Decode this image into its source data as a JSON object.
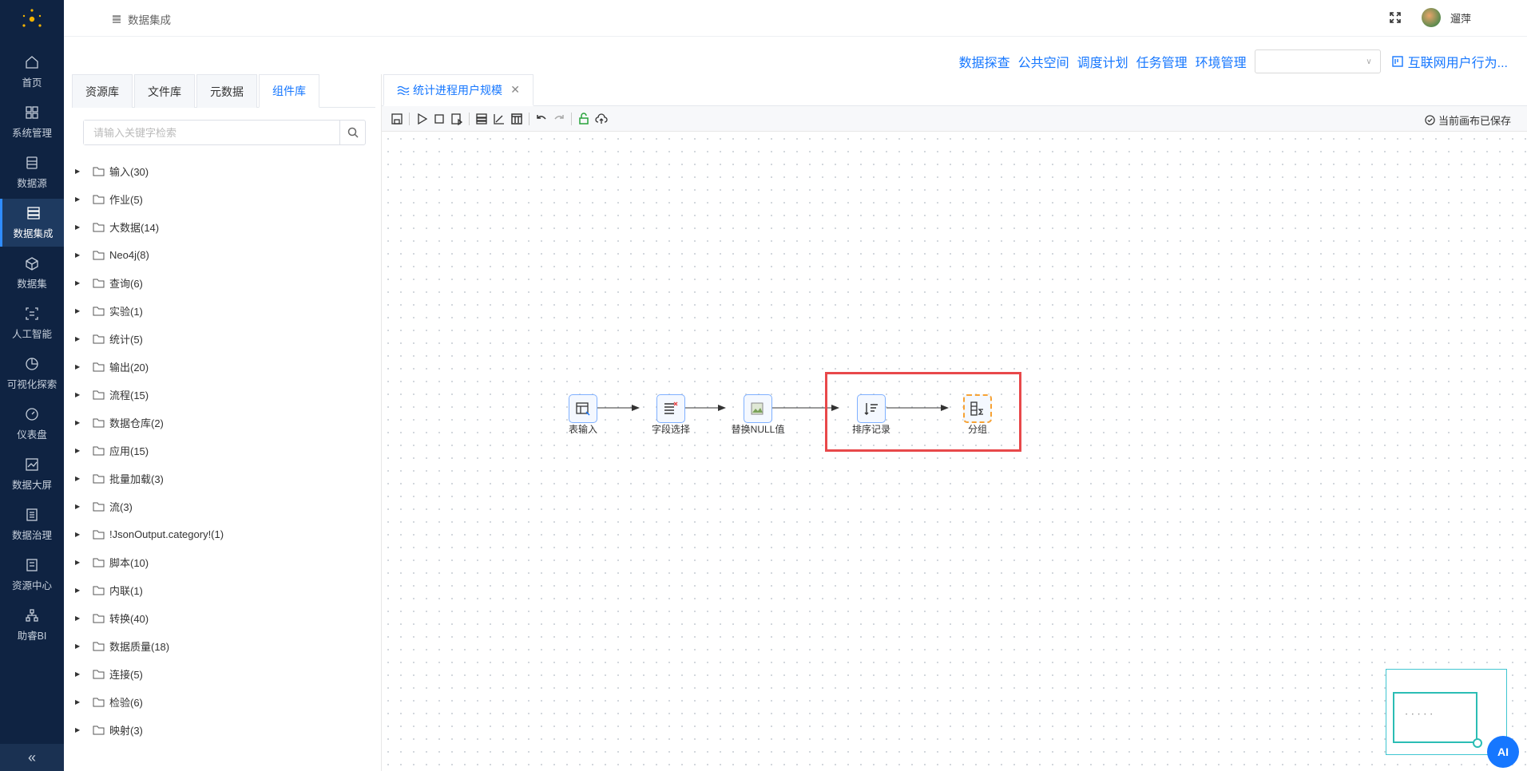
{
  "nav": {
    "items": [
      {
        "label": "首页",
        "icon": "home-icon"
      },
      {
        "label": "系统管理",
        "icon": "grid-icon"
      },
      {
        "label": "数据源",
        "icon": "database-icon"
      },
      {
        "label": "数据集成",
        "icon": "server-icon"
      },
      {
        "label": "数据集",
        "icon": "cube-icon"
      },
      {
        "label": "人工智能",
        "icon": "ai-icon"
      },
      {
        "label": "可视化探索",
        "icon": "pie-chart-icon"
      },
      {
        "label": "仪表盘",
        "icon": "gauge-icon"
      },
      {
        "label": "数据大屏",
        "icon": "line-chart-icon"
      },
      {
        "label": "数据治理",
        "icon": "document-icon"
      },
      {
        "label": "资源中心",
        "icon": "folder-icon"
      },
      {
        "label": "助睿BI",
        "icon": "network-icon"
      }
    ],
    "active_index": 3,
    "collapse_label": "«"
  },
  "header": {
    "breadcrumb": "数据集成",
    "user_name": "遛萍"
  },
  "toplinks": [
    "数据探查",
    "公共空间",
    "调度计划",
    "任务管理",
    "环境管理"
  ],
  "select_value": "",
  "internet_link": "互联网用户行为...",
  "panel": {
    "tabs": [
      "资源库",
      "文件库",
      "元数据",
      "组件库"
    ],
    "active_tab": 3,
    "search_placeholder": "请输入关键字检索",
    "tree": [
      "输入(30)",
      "作业(5)",
      "大数据(14)",
      "Neo4j(8)",
      "查询(6)",
      "实验(1)",
      "统计(5)",
      "输出(20)",
      "流程(15)",
      "数据仓库(2)",
      "应用(15)",
      "批量加载(3)",
      "流(3)",
      "!JsonOutput.category!(1)",
      "脚本(10)",
      "内联(1)",
      "转换(40)",
      "数据质量(18)",
      "连接(5)",
      "检验(6)",
      "映射(3)"
    ]
  },
  "editor": {
    "tab_title": "统计进程用户规模",
    "saved_status": "当前画布已保存",
    "nodes": [
      {
        "label": "表输入",
        "icon": "table-input-icon"
      },
      {
        "label": "字段选择",
        "icon": "field-select-icon"
      },
      {
        "label": "替换NULL值",
        "icon": "broken-image-icon"
      },
      {
        "label": "排序记录",
        "icon": "sort-icon"
      },
      {
        "label": "分组",
        "icon": "group-sum-icon"
      }
    ],
    "selected_node": 4
  },
  "ai_label": "AI",
  "colors": {
    "nav_bg": "#0f2342",
    "accent": "#1677ff",
    "highlight": "#e8484a"
  }
}
